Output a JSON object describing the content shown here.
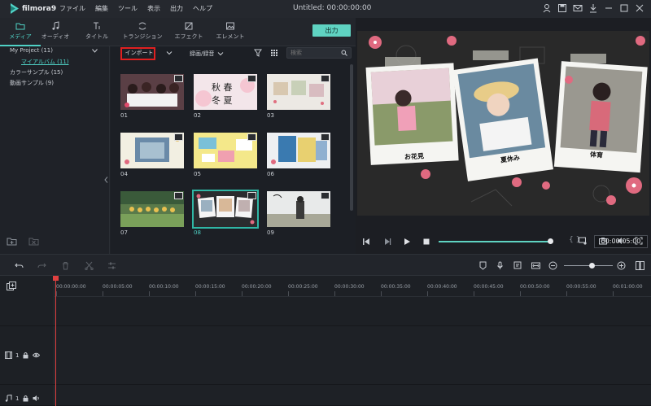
{
  "app": {
    "name": "filmora9",
    "doc_title": "Untitled:  00:00:00:00"
  },
  "menu": [
    "ファイル",
    "編集",
    "ツール",
    "表示",
    "出力",
    "ヘルプ"
  ],
  "media_tabs": [
    {
      "label": "メディア",
      "icon": "folder-icon",
      "active": true
    },
    {
      "label": "オーディオ",
      "icon": "music-note-icon",
      "active": false
    },
    {
      "label": "タイトル",
      "icon": "title-t-icon",
      "active": false
    },
    {
      "label": "トランジション",
      "icon": "transition-icon",
      "active": false
    },
    {
      "label": "エフェクト",
      "icon": "effect-icon",
      "active": false
    },
    {
      "label": "エレメント",
      "icon": "element-image-icon",
      "active": false
    }
  ],
  "export_label": "出力",
  "tree": {
    "project": "My Project (11)",
    "album": "マイアルバム (11)",
    "color_samples": "カラーサンプル (15)",
    "video_samples": "動画サンプル (9)"
  },
  "browser": {
    "import_label": "インポート",
    "record_label": "録画/録音",
    "search_placeholder": "検索"
  },
  "thumbnails": [
    {
      "label": "01",
      "selected": false
    },
    {
      "label": "02",
      "selected": false
    },
    {
      "label": "03",
      "selected": false
    },
    {
      "label": "04",
      "selected": false
    },
    {
      "label": "05",
      "selected": false
    },
    {
      "label": "06",
      "selected": false
    },
    {
      "label": "07",
      "selected": false
    },
    {
      "label": "08",
      "selected": true
    },
    {
      "label": "09",
      "selected": false
    }
  ],
  "preview": {
    "captions": [
      "お花見",
      "夏休み",
      "体育"
    ],
    "progress": 1.0,
    "timecode": "00:00:05:00",
    "braces": "{  }"
  },
  "ruler_labels": [
    "00:00:00:00",
    "00:00:05:00",
    "00:00:10:00",
    "00:00:15:00",
    "00:00:20:00",
    "00:00:25:00",
    "00:00:30:00",
    "00:00:35:00",
    "00:00:40:00",
    "00:00:45:00",
    "00:00:50:00",
    "00:00:55:00",
    "00:01:00:00"
  ],
  "tracks": [
    {
      "label": "1",
      "icon": "video-track-icon"
    },
    {
      "label": "1",
      "icon": "audio-track-icon"
    }
  ],
  "zoom_level": 0.55,
  "colors": {
    "accent": "#5fd3c2",
    "playhead": "#e04040",
    "import_highlight": "#e02020"
  }
}
